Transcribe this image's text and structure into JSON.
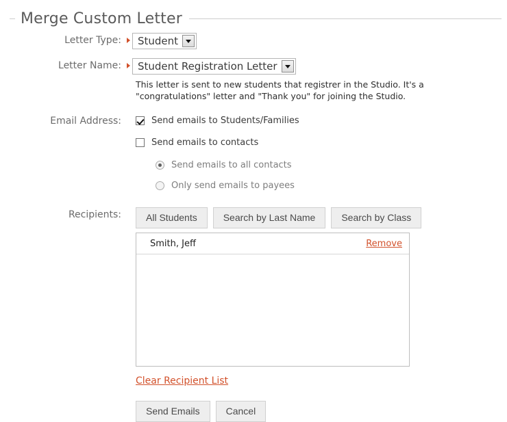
{
  "header": {
    "title": "Merge Custom Letter"
  },
  "form": {
    "letter_type": {
      "label": "Letter Type:",
      "value": "Student",
      "required_marker": "required-marker-icon",
      "dropdown_icon": "chevron-down-icon"
    },
    "letter_name": {
      "label": "Letter Name:",
      "value": "Student Registration Letter",
      "required_marker": "required-marker-icon",
      "dropdown_icon": "chevron-down-icon",
      "description": "This letter is sent to new students that registrer in the Studio. It's a \"congratulations\" letter and \"Thank you\" for joining the Studio."
    },
    "email_address": {
      "label": "Email Address:",
      "checkboxes": [
        {
          "label": "Send emails to Students/Families",
          "checked": true
        },
        {
          "label": "Send emails to contacts",
          "checked": false
        }
      ],
      "radios": [
        {
          "label": "Send emails to all contacts",
          "selected": true
        },
        {
          "label": "Only send emails to payees",
          "selected": false
        }
      ]
    },
    "recipients": {
      "label": "Recipients:",
      "buttons": [
        "All Students",
        "Search by Last Name",
        "Search by Class"
      ],
      "items": [
        {
          "name": "Smith, Jeff",
          "remove_label": "Remove"
        }
      ],
      "clear_link": "Clear Recipient List"
    }
  },
  "actions": {
    "submit": "Send Emails",
    "cancel": "Cancel"
  },
  "colors": {
    "link": "#d2512b",
    "title": "#5a5a5a",
    "label": "#6b6b6b",
    "button_bg": "#eeeeee",
    "border": "#cccccc"
  }
}
